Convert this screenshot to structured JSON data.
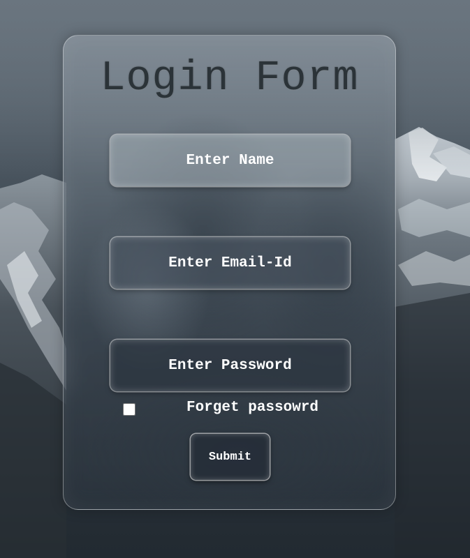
{
  "form": {
    "title": "Login Form",
    "name_placeholder": "Enter Name",
    "email_placeholder": "Enter Email-Id",
    "password_placeholder": "Enter Password",
    "forget_label": "Forget passowrd",
    "remember_checked": false,
    "submit_label": "Submit"
  },
  "colors": {
    "text": "#ffffff",
    "title": "#2b3338",
    "sky_top": "#616c76",
    "ground": "#222a31"
  }
}
